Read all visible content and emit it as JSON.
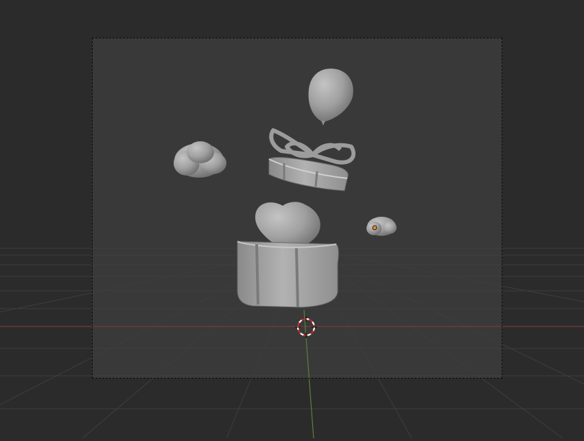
{
  "viewport": {
    "background": "#2b2b2b",
    "camera_region_color": "#3a3a3a",
    "grid_color": "#3c3c3c",
    "x_axis_color": "#8a3a3a",
    "y_axis_color": "#5d7d3a",
    "cursor_color": "#c62828"
  },
  "scene": {
    "objects": [
      {
        "name": "balloon",
        "kind": "mesh"
      },
      {
        "name": "bow",
        "kind": "mesh"
      },
      {
        "name": "gift-lid",
        "kind": "mesh"
      },
      {
        "name": "cloud-large",
        "kind": "mesh"
      },
      {
        "name": "cloud-small",
        "kind": "mesh",
        "has_origin_dot": true
      },
      {
        "name": "heart",
        "kind": "mesh"
      },
      {
        "name": "gift-box",
        "kind": "mesh"
      }
    ],
    "selected_origin_color": "#e38a1e"
  }
}
